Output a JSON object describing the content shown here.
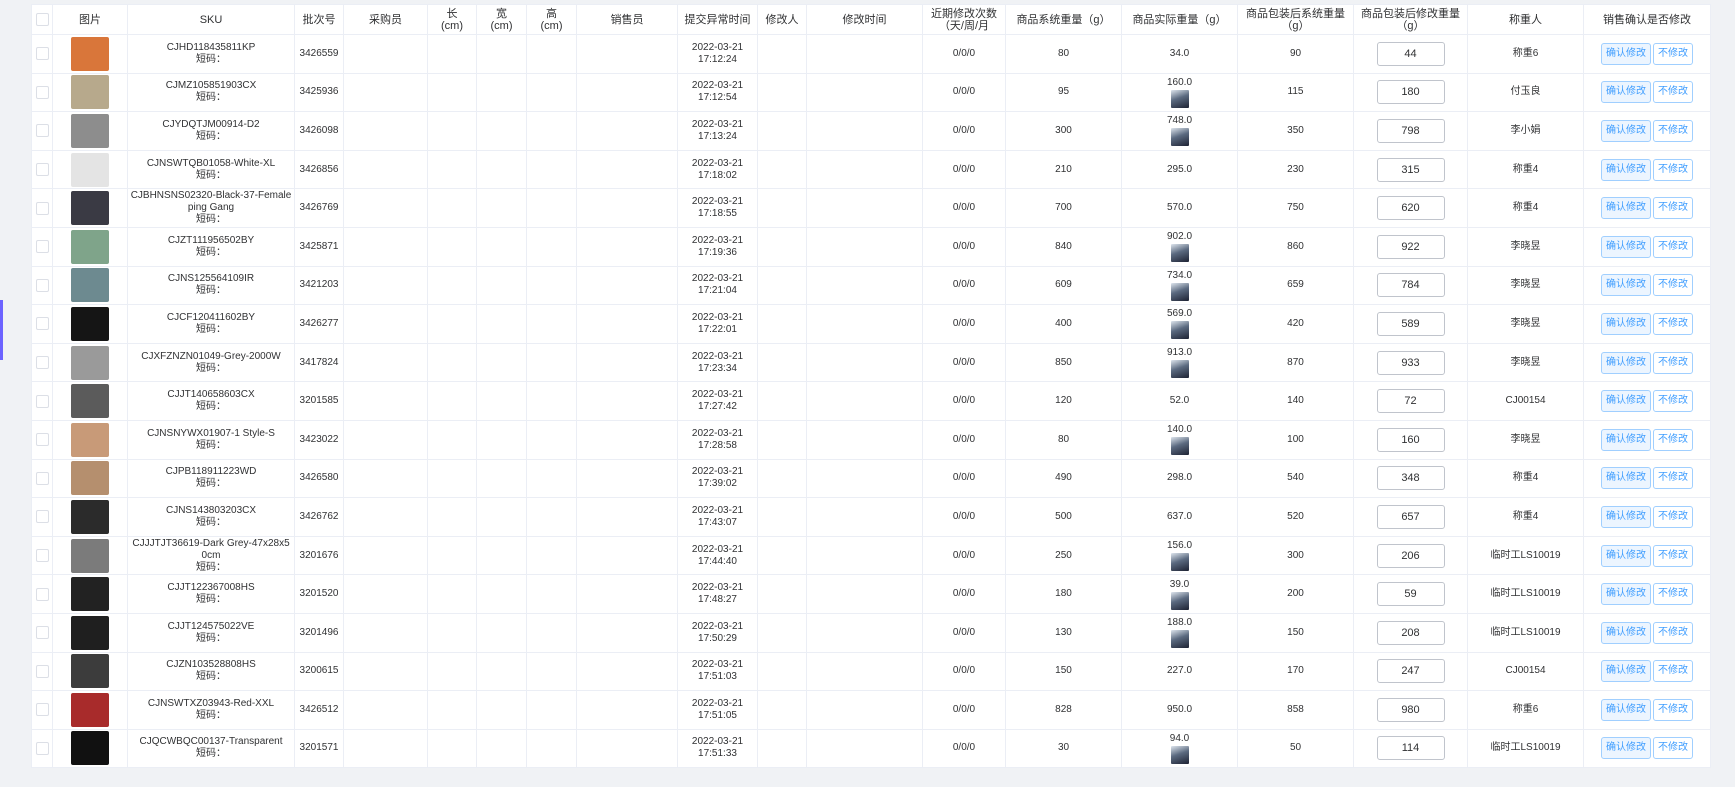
{
  "headers": {
    "pic": "图片",
    "sku": "SKU",
    "batch": "批次号",
    "buyer": "采购员",
    "length_label": "长",
    "width_label": "宽",
    "height_label": "高",
    "unit_cm": "(cm)",
    "seller": "销售员",
    "submit_time": "提交异常时间",
    "modifier": "修改人",
    "modify_time": "修改时间",
    "recent_count": "近期修改次数（天/周/月",
    "sys_weight": "商品系统重量（g）",
    "actual_weight": "商品实际重量（g）",
    "pkg_sys_weight": "商品包装后系统重量（g）",
    "pkg_mod_weight": "商品包装后修改重量（g）",
    "weigher": "称重人",
    "confirm": "销售确认是否修改"
  },
  "labels": {
    "short_code": "短码：",
    "confirm_btn": "确认修改",
    "reject_btn": "不修改"
  },
  "rows": [
    {
      "sku": "CJHD118435811KP",
      "batch": "3426559",
      "date": "2022-03-21",
      "time": "17:12:24",
      "count": "0/0/0",
      "sys": "80",
      "actual": "34.0",
      "has_img": false,
      "pkg": "90",
      "mod": "44",
      "weigher": "称重6",
      "thumb": "#d9763a"
    },
    {
      "sku": "CJMZ105851903CX",
      "batch": "3425936",
      "date": "2022-03-21",
      "time": "17:12:54",
      "count": "0/0/0",
      "sys": "95",
      "actual": "160.0",
      "has_img": true,
      "pkg": "115",
      "mod": "180",
      "weigher": "付玉良",
      "thumb": "#b7a98c"
    },
    {
      "sku": "CJYDQTJM00914-D2",
      "batch": "3426098",
      "date": "2022-03-21",
      "time": "17:13:24",
      "count": "0/0/0",
      "sys": "300",
      "actual": "748.0",
      "has_img": true,
      "pkg": "350",
      "mod": "798",
      "weigher": "李小娟",
      "thumb": "#8d8d8d"
    },
    {
      "sku": "CJNSWTQB01058-White-XL",
      "batch": "3426856",
      "date": "2022-03-21",
      "time": "17:18:02",
      "count": "0/0/0",
      "sys": "210",
      "actual": "295.0",
      "has_img": false,
      "pkg": "230",
      "mod": "315",
      "weigher": "称重4",
      "thumb": "#e4e4e4"
    },
    {
      "sku": "CJBHNSNS02320-Black-37-Female ping Gang",
      "batch": "3426769",
      "date": "2022-03-21",
      "time": "17:18:55",
      "count": "0/0/0",
      "sys": "700",
      "actual": "570.0",
      "has_img": false,
      "pkg": "750",
      "mod": "620",
      "weigher": "称重4",
      "thumb": "#3a3a44"
    },
    {
      "sku": "CJZT111956502BY",
      "batch": "3425871",
      "date": "2022-03-21",
      "time": "17:19:36",
      "count": "0/0/0",
      "sys": "840",
      "actual": "902.0",
      "has_img": true,
      "pkg": "860",
      "mod": "922",
      "weigher": "李晓昱",
      "thumb": "#7fa48a"
    },
    {
      "sku": "CJNS125564109IR",
      "batch": "3421203",
      "date": "2022-03-21",
      "time": "17:21:04",
      "count": "0/0/0",
      "sys": "609",
      "actual": "734.0",
      "has_img": true,
      "pkg": "659",
      "mod": "784",
      "weigher": "李晓昱",
      "thumb": "#6d8a90"
    },
    {
      "sku": "CJCF120411602BY",
      "batch": "3426277",
      "date": "2022-03-21",
      "time": "17:22:01",
      "count": "0/0/0",
      "sys": "400",
      "actual": "569.0",
      "has_img": true,
      "pkg": "420",
      "mod": "589",
      "weigher": "李晓昱",
      "thumb": "#151515"
    },
    {
      "sku": "CJXFZNZN01049-Grey-2000W",
      "batch": "3417824",
      "date": "2022-03-21",
      "time": "17:23:34",
      "count": "0/0/0",
      "sys": "850",
      "actual": "913.0",
      "has_img": true,
      "pkg": "870",
      "mod": "933",
      "weigher": "李晓昱",
      "thumb": "#9a9a9a"
    },
    {
      "sku": "CJJT140658603CX",
      "batch": "3201585",
      "date": "2022-03-21",
      "time": "17:27:42",
      "count": "0/0/0",
      "sys": "120",
      "actual": "52.0",
      "has_img": false,
      "pkg": "140",
      "mod": "72",
      "weigher": "CJ00154",
      "thumb": "#5b5b5b"
    },
    {
      "sku": "CJNSNYWX01907-1 Style-S",
      "batch": "3423022",
      "date": "2022-03-21",
      "time": "17:28:58",
      "count": "0/0/0",
      "sys": "80",
      "actual": "140.0",
      "has_img": true,
      "pkg": "100",
      "mod": "160",
      "weigher": "李晓昱",
      "thumb": "#c89a78"
    },
    {
      "sku": "CJPB118911223WD",
      "batch": "3426580",
      "date": "2022-03-21",
      "time": "17:39:02",
      "count": "0/0/0",
      "sys": "490",
      "actual": "298.0",
      "has_img": false,
      "pkg": "540",
      "mod": "348",
      "weigher": "称重4",
      "thumb": "#b58f6e"
    },
    {
      "sku": "CJNS143803203CX",
      "batch": "3426762",
      "date": "2022-03-21",
      "time": "17:43:07",
      "count": "0/0/0",
      "sys": "500",
      "actual": "637.0",
      "has_img": false,
      "pkg": "520",
      "mod": "657",
      "weigher": "称重4",
      "thumb": "#2b2b2b"
    },
    {
      "sku": "CJJJTJT36619-Dark Grey-47x28x50cm",
      "batch": "3201676",
      "date": "2022-03-21",
      "time": "17:44:40",
      "count": "0/0/0",
      "sys": "250",
      "actual": "156.0",
      "has_img": true,
      "pkg": "300",
      "mod": "206",
      "weigher": "临时工LS10019",
      "thumb": "#7b7b7b"
    },
    {
      "sku": "CJJT122367008HS",
      "batch": "3201520",
      "date": "2022-03-21",
      "time": "17:48:27",
      "count": "0/0/0",
      "sys": "180",
      "actual": "39.0",
      "has_img": true,
      "pkg": "200",
      "mod": "59",
      "weigher": "临时工LS10019",
      "thumb": "#222"
    },
    {
      "sku": "CJJT124575022VE",
      "batch": "3201496",
      "date": "2022-03-21",
      "time": "17:50:29",
      "count": "0/0/0",
      "sys": "130",
      "actual": "188.0",
      "has_img": true,
      "pkg": "150",
      "mod": "208",
      "weigher": "临时工LS10019",
      "thumb": "#1f1f1f"
    },
    {
      "sku": "CJZN103528808HS",
      "batch": "3200615",
      "date": "2022-03-21",
      "time": "17:51:03",
      "count": "0/0/0",
      "sys": "150",
      "actual": "227.0",
      "has_img": false,
      "pkg": "170",
      "mod": "247",
      "weigher": "CJ00154",
      "thumb": "#3c3c3c"
    },
    {
      "sku": "CJNSWTXZ03943-Red-XXL",
      "batch": "3426512",
      "date": "2022-03-21",
      "time": "17:51:05",
      "count": "0/0/0",
      "sys": "828",
      "actual": "950.0",
      "has_img": false,
      "pkg": "858",
      "mod": "980",
      "weigher": "称重6",
      "thumb": "#a82b2b"
    },
    {
      "sku": "CJQCWBQC00137-Transparent",
      "batch": "3201571",
      "date": "2022-03-21",
      "time": "17:51:33",
      "count": "0/0/0",
      "sys": "30",
      "actual": "94.0",
      "has_img": true,
      "pkg": "50",
      "mod": "114",
      "weigher": "临时工LS10019",
      "thumb": "#111"
    }
  ]
}
